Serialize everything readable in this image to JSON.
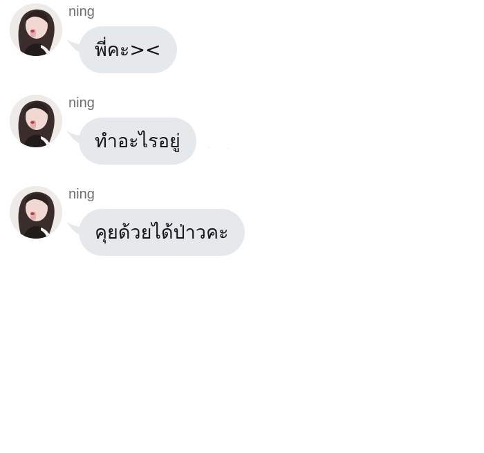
{
  "messages": [
    {
      "sender": "ning",
      "text": "พี่คะ><",
      "avatar_icon": "profile-photo-avatar"
    },
    {
      "sender": "ning",
      "text": "ทำอะไรอยู่",
      "avatar_icon": "profile-photo-avatar"
    },
    {
      "sender": "ning",
      "text": "คุยด้วยได้ป่าวคะ",
      "avatar_icon": "profile-photo-avatar"
    }
  ],
  "colors": {
    "bubble": "#e6e9ec",
    "sender_name": "#6d6f73",
    "message_text": "#161616",
    "background": "#ffffff"
  }
}
